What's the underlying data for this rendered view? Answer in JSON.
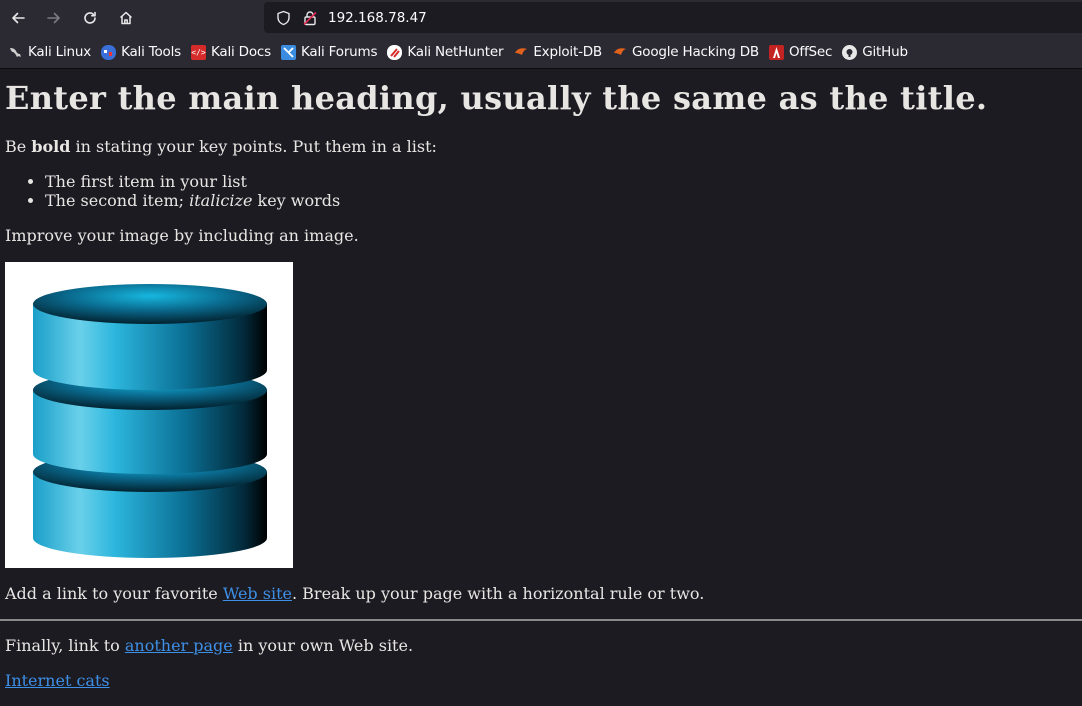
{
  "browser": {
    "url": "192.168.78.47",
    "nav": {
      "back": "back-arrow",
      "forward": "forward-arrow",
      "reload": "reload-icon",
      "home": "home-icon"
    }
  },
  "bookmarks": [
    {
      "label": "Kali Linux",
      "icon": "kali-dragon-icon",
      "color": "#cfcfcf"
    },
    {
      "label": "Kali Tools",
      "icon": "kali-tools-icon",
      "color": "#3a6fd8"
    },
    {
      "label": "Kali Docs",
      "icon": "kali-docs-icon",
      "color": "#d52b2b"
    },
    {
      "label": "Kali Forums",
      "icon": "kali-forums-icon",
      "color": "#3a8ce0"
    },
    {
      "label": "Kali NetHunter",
      "icon": "kali-nethunter-icon",
      "color": "#d52b2b"
    },
    {
      "label": "Exploit-DB",
      "icon": "exploit-db-icon",
      "color": "#e0621c"
    },
    {
      "label": "Google Hacking DB",
      "icon": "ghdb-icon",
      "color": "#e0621c"
    },
    {
      "label": "OffSec",
      "icon": "offsec-icon",
      "color": "#c42323"
    },
    {
      "label": "GitHub",
      "icon": "github-icon",
      "color": "#e8e8e8"
    }
  ],
  "page": {
    "heading": "Enter the main heading, usually the same as the title.",
    "intro_before": "Be ",
    "intro_bold": "bold",
    "intro_after": " in stating your key points. Put them in a list:",
    "list": {
      "item1": "The first item in your list",
      "item2_before": "The second item; ",
      "item2_italic": "italicize",
      "item2_after": " key words"
    },
    "improve_text": "Improve your image by including an image.",
    "image_icon": "database-icon",
    "link_para_before": "Add a link to your favorite ",
    "link_para_link": "Web site",
    "link_para_after": ". Break up your page with a horizontal rule or two.",
    "final_before": "Finally, link to ",
    "final_link": "another page",
    "final_after": " in your own Web site.",
    "cats_link": "Internet cats"
  }
}
